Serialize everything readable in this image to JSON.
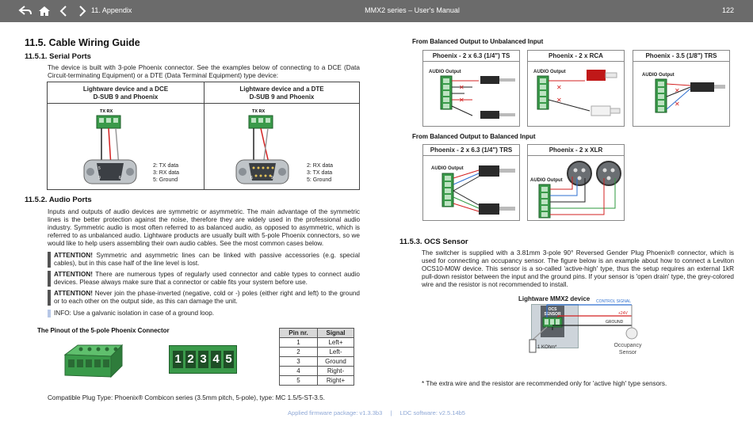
{
  "header": {
    "section": "11. Appendix",
    "title": "MMX2 series – User's Manual",
    "page": "122"
  },
  "left": {
    "h1": "11.5. Cable Wiring Guide",
    "serial": {
      "heading": "11.5.1. Serial Ports",
      "text": "The device is built with 3-pole Phoenix connector. See the examples below of connecting to a DCE (Data Circuit-terminating Equipment) or a DTE (Data Terminal Equipment) type device:",
      "col1_title_l1": "Lightware device and a DCE",
      "col1_title_l2": "D-SUB 9 and Phoenix",
      "col2_title_l1": "Lightware device and a DTE",
      "col2_title_l2": "D-SUB 9 and Phoenix",
      "txrx": "TX RX",
      "dce_pins": [
        "2: TX data",
        "3: RX data",
        "5: Ground"
      ],
      "dte_pins": [
        "2: RX data",
        "3: TX data",
        "5: Ground"
      ]
    },
    "audio": {
      "heading": "11.5.2. Audio Ports",
      "text": "Inputs and outputs of audio devices are symmetric or asymmetric. The main advantage of the symmetric lines is the better protection against the noise, therefore they are widely used in the professional audio industry. Symmetric audio is most often referred to as balanced audio, as opposed to asymmetric, which is referred to as unbalanced audio. Lightware products are usually built with 5-pole Phoenix connectors, so we would like to help users assembling their own audio cables. See the most common cases below.",
      "attention_label": "ATTENTION!",
      "attn1": "Symmetric and asymmetric lines can be linked with passive accessories (e.g. special cables), but in this case half of the line level is lost.",
      "attn2": "There are numerous types of regularly used connector and cable types to connect audio devices. Please always make sure that a connector or cable fits your system before use.",
      "attn3": "Never join the phase-inverted (negative, cold or -) poles (either right and left) to the ground or to each other on the output side, as this can damage the unit.",
      "info": "INFO: Use a galvanic isolation in case of a ground loop.",
      "pinout_title": "The Pinout of the 5-pole Phoenix Connector",
      "pin_digits": [
        "1",
        "2",
        "3",
        "4",
        "5"
      ],
      "pin_table": {
        "headers": [
          "Pin nr.",
          "Signal"
        ],
        "rows": [
          [
            "1",
            "Left+"
          ],
          [
            "2",
            "Left-"
          ],
          [
            "3",
            "Ground"
          ],
          [
            "4",
            "Right-"
          ],
          [
            "5",
            "Right+"
          ]
        ]
      },
      "compat": "Compatible Plug Type: Phoenix® Combicon series (3.5mm pitch, 5-pole), type: MC 1.5/5-ST-3.5."
    }
  },
  "right": {
    "bal_unbal": "From Balanced Output to Unbalanced Input",
    "panels_top": [
      "Phoenix - 2 x 6.3 (1/4\") TS",
      "Phoenix - 2 x RCA",
      "Phoenix - 3.5 (1/8\") TRS"
    ],
    "bal_bal": "From Balanced Output to Balanced Input",
    "panels_bottom": [
      "Phoenix - 2 x 6.3 (1/4\") TRS",
      "Phoenix - 2 x XLR"
    ],
    "audio_output": "AUDIO Output",
    "ocs": {
      "heading": "11.5.3. OCS Sensor",
      "text": "The switcher is supplied with a 3.81mm 3-pole 90° Reversed Gender Plug Phoenix® connector, which is used for connecting an occupancy sensor. The figure below is an example about how to connect a Leviton OCS10-M0W device. This sensor is a so-called 'active-high' type, thus the setup requires an external 1kR pull-down resistor between the input and the ground pins. If your sensor is 'open drain' type, the grey-colored wire and the resistor is not recommended to install.",
      "diagram_title": "Lightware MMX2 device",
      "ocs_label_l1": "OCS",
      "ocs_label_l2": "SENSOR",
      "control_signal": "CONTROL SIGNAL",
      "v24": "+24V",
      "ground": "GROUND",
      "resistor": "1 KOhm*",
      "sensor_l1": "Occupancy",
      "sensor_l2": "Sensor",
      "note": "* The extra wire and the resistor are recommended only for 'active high' type sensors."
    }
  },
  "footer": {
    "firmware": "Applied firmware package: v1.3.3b3",
    "sep": "|",
    "ldc": "LDC software: v2.5.14b5"
  },
  "colors": {
    "topbar": "#6b6b6b",
    "connector_green": "#3a9a4a",
    "wire_red": "#d32020",
    "wire_blue": "#2e6fd0",
    "wire_green": "#2e9a3e",
    "link_blue": "#8fa8d6"
  }
}
